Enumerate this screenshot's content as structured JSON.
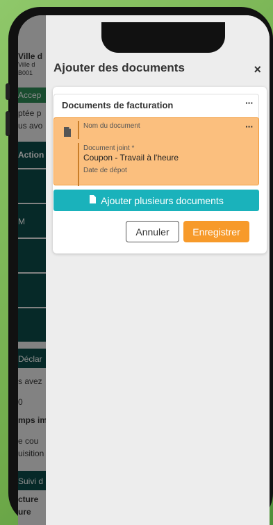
{
  "background_page": {
    "strips": [
      "Ville d",
      "Ville d",
      "B001",
      "Accep",
      "ptée p",
      "us avo",
      "Action",
      "",
      "M",
      "",
      "",
      "",
      "Déclar",
      "s avez",
      "0",
      "mps imp",
      "e cou",
      "uisition",
      "Suivi d",
      "cture",
      "ure"
    ]
  },
  "modal": {
    "title": "Ajouter des documents",
    "close": "×",
    "section": {
      "title": "Documents de facturation",
      "menu": "···"
    },
    "document": {
      "menu": "···",
      "name_label": "Nom du document",
      "file_label": "Document joint *",
      "file_value": "Coupon - Travail à l'heure",
      "date_label": "Date de dépot"
    },
    "add_button": "Ajouter plusieurs documents",
    "cancel_button": "Annuler",
    "save_button": "Enregistrer"
  },
  "colors": {
    "accent_teal": "#1ab2bb",
    "save_orange": "#f79a2a",
    "doc_bg": "#fbbf7e"
  }
}
